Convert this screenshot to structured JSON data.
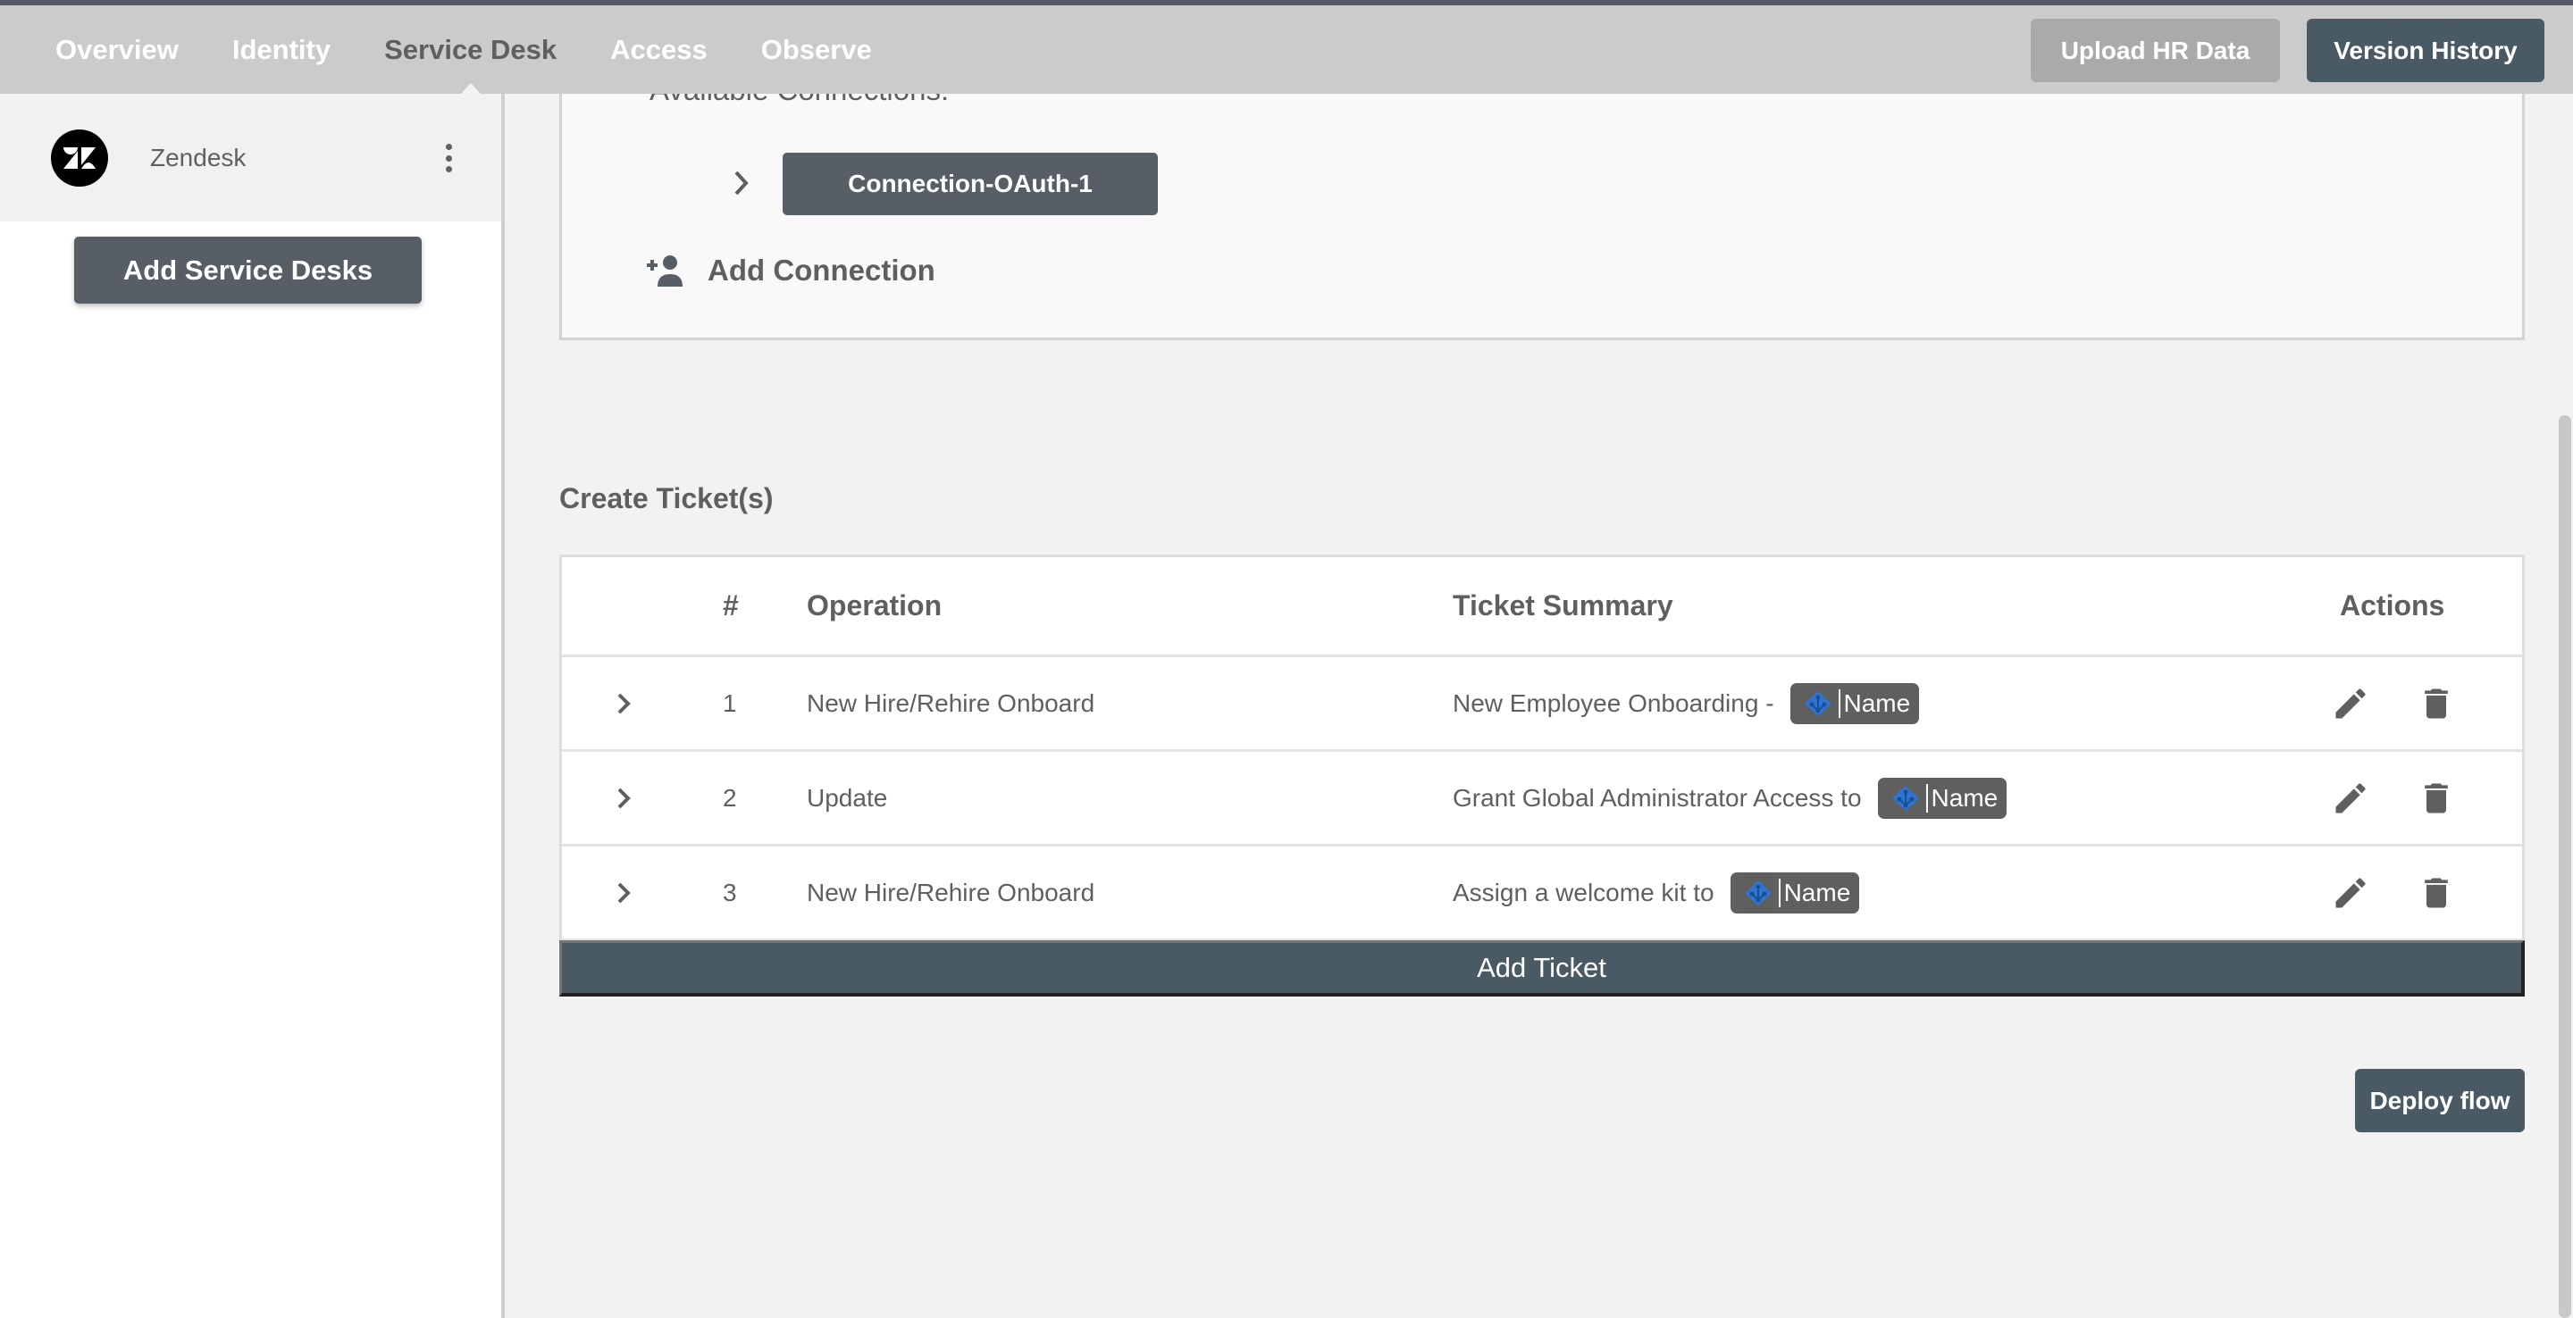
{
  "nav": {
    "tabs": [
      {
        "label": "Overview",
        "active": false
      },
      {
        "label": "Identity",
        "active": false
      },
      {
        "label": "Service Desk",
        "active": true
      },
      {
        "label": "Access",
        "active": false
      },
      {
        "label": "Observe",
        "active": false
      }
    ],
    "upload_label": "Upload HR Data",
    "version_label": "Version History"
  },
  "sidebar": {
    "service_desks": [
      {
        "name": "Zendesk",
        "icon": "zendesk-logo-icon"
      }
    ],
    "add_label": "Add Service Desks"
  },
  "connections": {
    "heading": "Available Connections:",
    "items": [
      {
        "label": "Connection-OAuth-1"
      }
    ],
    "add_label": "Add Connection"
  },
  "tickets": {
    "title": "Create Ticket(s)",
    "columns": {
      "num": "#",
      "operation": "Operation",
      "summary": "Ticket Summary",
      "actions": "Actions"
    },
    "rows": [
      {
        "num": "1",
        "operation": "New Hire/Rehire Onboard",
        "summary": "New Employee Onboarding -",
        "chip": "Name"
      },
      {
        "num": "2",
        "operation": "Update",
        "summary": "Grant Global Administrator Access to",
        "chip": "Name"
      },
      {
        "num": "3",
        "operation": "New Hire/Rehire Onboard",
        "summary": "Assign a welcome kit to",
        "chip": "Name"
      }
    ],
    "add_label": "Add Ticket"
  },
  "deploy_label": "Deploy flow",
  "colors": {
    "primary_button": "#4a5a65",
    "secondary_button": "#575e66",
    "disabled_button": "#a9aaab",
    "navbar": "#cbcbcb",
    "chip_bg": "#5f5f5f",
    "chip_icon": "#2f74d0"
  }
}
